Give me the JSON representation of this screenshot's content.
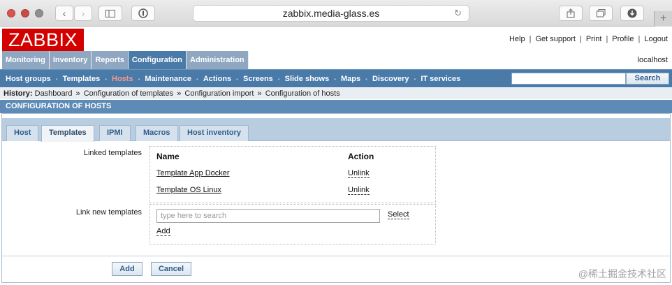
{
  "browser": {
    "url": "zabbix.media-glass.es",
    "new_tab": "+"
  },
  "header": {
    "logo": "ZABBIX",
    "links": [
      "Help",
      "Get support",
      "Print",
      "Profile",
      "Logout"
    ],
    "separator": "|",
    "host": "localhost"
  },
  "main_menu": [
    "Monitoring",
    "Inventory",
    "Reports",
    "Configuration",
    "Administration"
  ],
  "sub_menu": {
    "items": [
      "Host groups",
      "Templates",
      "Hosts",
      "Maintenance",
      "Actions",
      "Screens",
      "Slide shows",
      "Maps",
      "Discovery",
      "IT services"
    ],
    "separator": "•",
    "search_value": "",
    "search_button": "Search"
  },
  "history": {
    "label": "History:",
    "items": [
      "Dashboard",
      "Configuration of templates",
      "Configuration import",
      "Configuration of hosts"
    ],
    "separator": "»"
  },
  "page_title": "CONFIGURATION OF HOSTS",
  "tabs": [
    "Host",
    "Templates",
    "IPMI",
    "Macros",
    "Host inventory"
  ],
  "linked_templates": {
    "label": "Linked templates",
    "col_name": "Name",
    "col_action": "Action",
    "rows": [
      {
        "name": "Template App Docker",
        "action": "Unlink"
      },
      {
        "name": "Template OS Linux",
        "action": "Unlink"
      }
    ]
  },
  "link_new": {
    "label": "Link new templates",
    "placeholder": "type here to search",
    "select": "Select",
    "add": "Add"
  },
  "buttons": {
    "add": "Add",
    "cancel": "Cancel"
  },
  "watermark": "@稀土掘金技术社区",
  "colors": {
    "logo_red": "#d40000",
    "menu_blue": "#4a7aa8",
    "menu_light": "#8fa7c1",
    "active_submenu": "#f29a8e"
  }
}
